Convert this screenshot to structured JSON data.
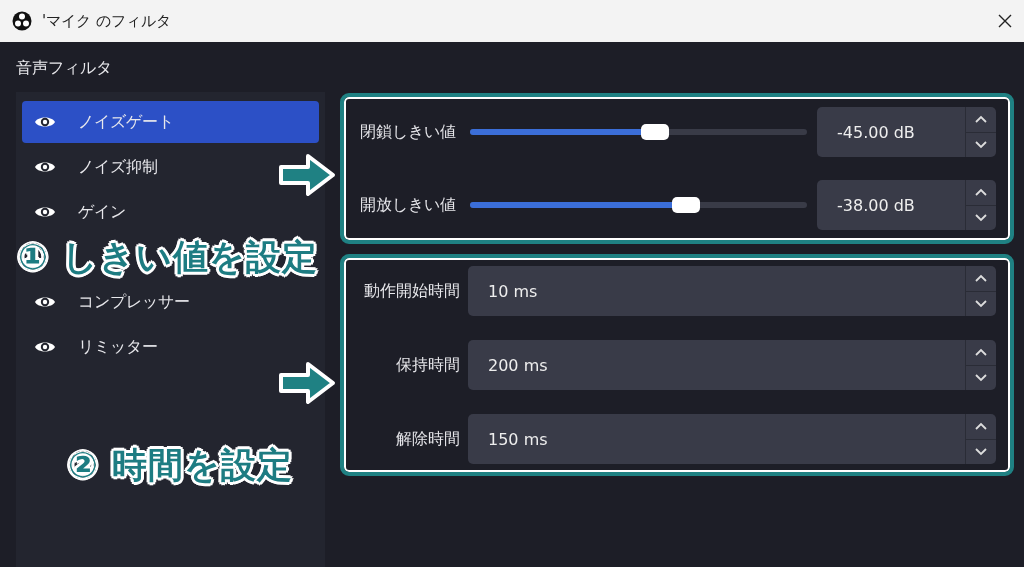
{
  "window": {
    "title": "'マイク のフィルタ"
  },
  "sidebar": {
    "header": "音声フィルタ",
    "items": [
      {
        "kind": "filter",
        "label": "ノイズゲート",
        "selected": true
      },
      {
        "kind": "filter",
        "label": "ノイズ抑制",
        "selected": false
      },
      {
        "kind": "filter",
        "label": "ゲイン",
        "selected": false
      },
      {
        "kind": "note",
        "label": "① しきい値を設定"
      },
      {
        "kind": "filter",
        "label": "コンプレッサー",
        "selected": false
      },
      {
        "kind": "filter",
        "label": "リミッター",
        "selected": false
      }
    ]
  },
  "groups": [
    {
      "rows": [
        {
          "kind": "slider",
          "label": "閉鎖しきい値",
          "level": 0.55,
          "value": "-45.00 dB"
        },
        {
          "kind": "slider",
          "label": "開放しきい値",
          "level": 0.64,
          "value": "-38.00 dB"
        }
      ]
    },
    {
      "note": "② 時間を設定",
      "rows": [
        {
          "kind": "spin",
          "label": "動作開始時間",
          "value": "10 ms"
        },
        {
          "kind": "spin",
          "label": "保持時間",
          "value": "200 ms"
        },
        {
          "kind": "spin",
          "label": "解除時間",
          "value": "150 ms"
        }
      ]
    }
  ]
}
